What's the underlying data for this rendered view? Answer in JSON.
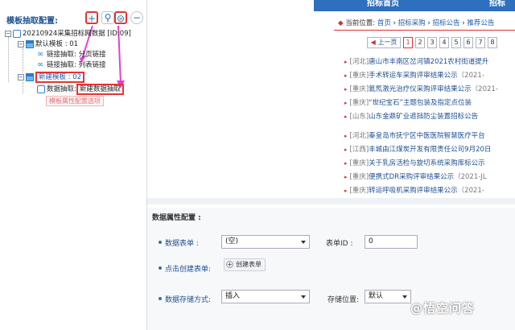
{
  "left_panel": {
    "title": "模板抽取配置:",
    "toolbar": {
      "add": "+",
      "link": "⚲",
      "extract": "⊜",
      "collapse": "−"
    },
    "tree": {
      "root": "20210924采集招标网数据 [ID:09]",
      "template1": "默认模板 : 01",
      "link1": "链接抽取: 分页链接",
      "link2": "链接抽取: 列表链接",
      "template2": "新建模板 : 02",
      "data_extract_label": "数据抽取:",
      "data_extract_name": "新建数据抽取",
      "hint": "模板属性配置选项"
    }
  },
  "site": {
    "tabs": [
      "招标首页",
      "招标"
    ],
    "location_label": "当前位置:",
    "breadcrumb": [
      "首页",
      "招标采购",
      "招标公告",
      "推荐公告"
    ],
    "pager": {
      "prev": "上一页",
      "pages": [
        "1",
        "2",
        "3",
        "4",
        "5",
        "6",
        "7",
        "8"
      ],
      "current": "1"
    },
    "items": [
      {
        "region": "[河北]",
        "title": "唐山市丰南区岔河镇2021农村街道提升",
        "date": ""
      },
      {
        "region": "[重庆]",
        "title": "手术转运车采购评审结果公示",
        "date": "（2021-"
      },
      {
        "region": "[重庆]",
        "title": "氦氖激光治疗仪采购评审结果公示",
        "date": "（2021-"
      },
      {
        "region": "[重庆]",
        "title": "“世纪宝石”主题包装及指定点位装",
        "date": ""
      },
      {
        "region": "[山东]",
        "title": "山东金鼎矿业遮挡防尘装置招标公告",
        "date": ""
      },
      {
        "region": "[河北]",
        "title": "秦皇岛市抚宁区中医医院智慧医疗平台",
        "date": ""
      },
      {
        "region": "[江西]",
        "title": "丰城由江煤炭开发有限责任公司9月20日",
        "date": ""
      },
      {
        "region": "[重庆]",
        "title": "关于乳房活检与旋切系统采购库标公示",
        "date": ""
      },
      {
        "region": "[重庆]",
        "title": "便携式DR采购评审结果公示",
        "date": "（2021-JL"
      },
      {
        "region": "[重庆]",
        "title": "转运呼吸机采购评审结果公示",
        "date": "（2021-"
      }
    ]
  },
  "form": {
    "header": "数据属性配置 :",
    "table_label": "数据表单 :",
    "table_value": "(空)",
    "form_id_label": "表单ID :",
    "form_id_value": "0",
    "create_label": "点击创建表单:",
    "create_button": "创建表单",
    "store_label": "数据存储方式:",
    "store_value": "插入",
    "position_label": "存储位置:",
    "position_value": "默认"
  },
  "watermark": "@悟空问答",
  "colors": {
    "accent": "#2e6fbf",
    "highlight": "#e53333",
    "arrow": "#e040d0"
  }
}
